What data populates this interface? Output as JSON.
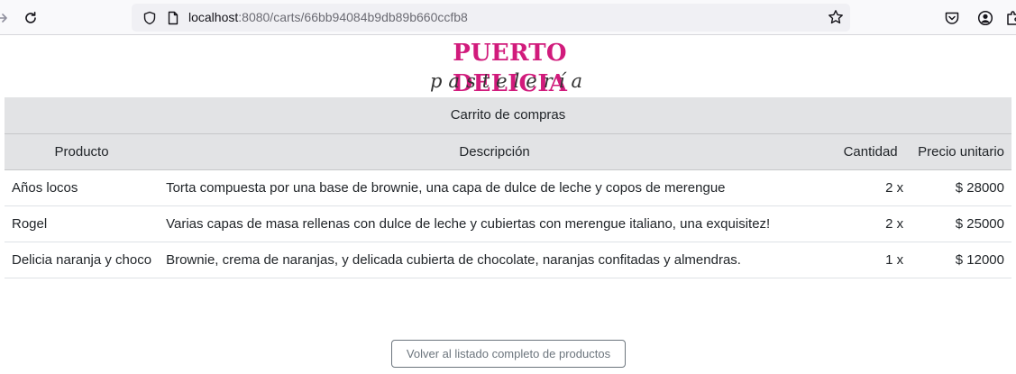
{
  "browser": {
    "url_host": "localhost",
    "url_rest": ":8080/carts/66bb94084b9db89b660ccfb8",
    "icons": [
      "forward-arrow-icon",
      "reload-icon",
      "shield-icon",
      "page-icon",
      "bookmark-star-icon",
      "pocket-icon",
      "account-icon",
      "extensions-icon"
    ]
  },
  "logo": {
    "title": "PUERTO DELICIA",
    "subtitle": "pastelería",
    "color": "#d11b7c"
  },
  "cart": {
    "caption": "Carrito de compras",
    "columns": [
      "Producto",
      "Descripción",
      "Cantidad",
      "Precio unitario"
    ],
    "rows": [
      {
        "product": "Años locos",
        "description": "Torta compuesta por una base de brownie, una capa de dulce de leche y copos de merengue",
        "quantity": "2 x",
        "price": "$ 28000"
      },
      {
        "product": "Rogel",
        "description": "Varias capas de masa rellenas con dulce de leche y cubiertas con merengue italiano, una exquisitez!",
        "quantity": "2 x",
        "price": "$ 25000"
      },
      {
        "product": "Delicia naranja y choco",
        "description": "Brownie, crema de naranjas, y delicada cubierta de chocolate, naranjas confitadas y almendras.",
        "quantity": "1 x",
        "price": "$ 12000"
      }
    ]
  },
  "back_button": {
    "label": "Volver al listado completo de productos"
  }
}
